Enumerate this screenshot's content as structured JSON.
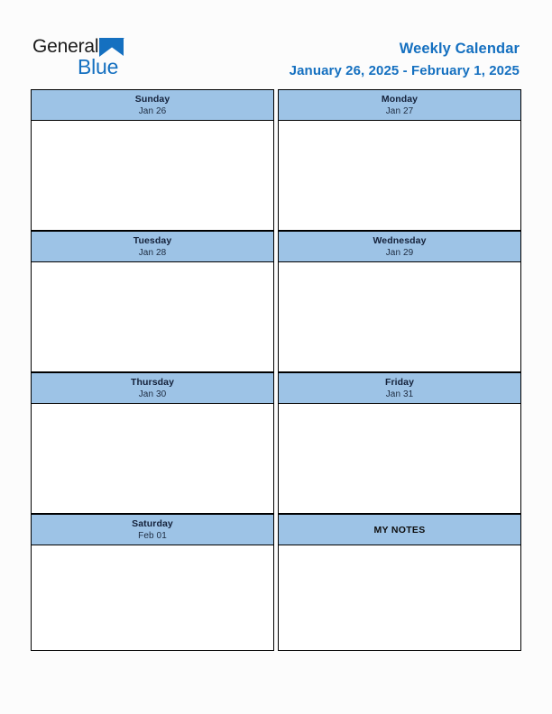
{
  "brand": {
    "name_part1": "General",
    "name_part2": "Blue",
    "triangle_color": "#1570c0",
    "text_color": "#1a1a1a"
  },
  "header": {
    "title": "Weekly Calendar",
    "date_range": "January 26, 2025 - February 1, 2025",
    "accent_color": "#1570c0"
  },
  "theme": {
    "header_cell_bg": "#9dc3e6",
    "body_cell_bg": "#ffffff",
    "border_color": "#000000",
    "page_bg": "#fcfcfc"
  },
  "calendar": {
    "rows": [
      {
        "left": {
          "day": "Sunday",
          "date": "Jan 26",
          "note": ""
        },
        "right": {
          "day": "Monday",
          "date": "Jan 27",
          "note": ""
        }
      },
      {
        "left": {
          "day": "Tuesday",
          "date": "Jan 28",
          "note": ""
        },
        "right": {
          "day": "Wednesday",
          "date": "Jan 29",
          "note": ""
        }
      },
      {
        "left": {
          "day": "Thursday",
          "date": "Jan 30",
          "note": ""
        },
        "right": {
          "day": "Friday",
          "date": "Jan 31",
          "note": ""
        }
      },
      {
        "left": {
          "day": "Saturday",
          "date": "Feb 01",
          "note": ""
        },
        "right": {
          "day": "MY NOTES",
          "date": "",
          "note": ""
        }
      }
    ]
  }
}
